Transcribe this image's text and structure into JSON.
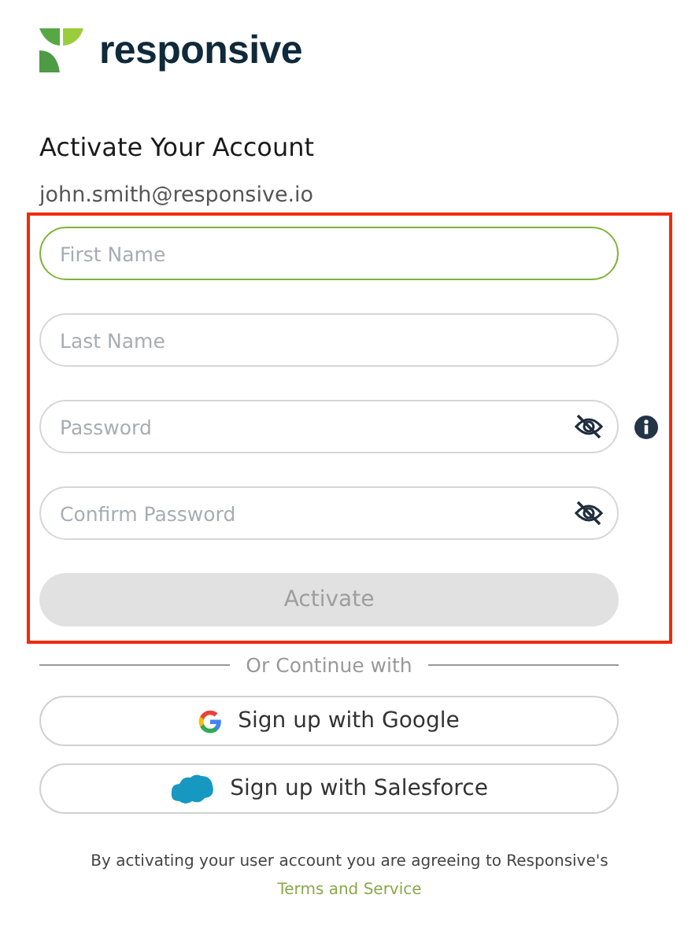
{
  "brand": {
    "name": "responsive"
  },
  "heading": "Activate Your Account",
  "email": "john.smith@responsive.io",
  "highlight": {
    "shown": true
  },
  "fields": [
    {
      "kind": "text",
      "placeholder": "First Name",
      "focused": true
    },
    {
      "kind": "text",
      "placeholder": "Last Name",
      "focused": false
    },
    {
      "kind": "password",
      "placeholder": "Password",
      "focused": false,
      "info": true
    },
    {
      "kind": "password",
      "placeholder": "Confirm Password",
      "focused": false,
      "info": false
    }
  ],
  "activate_button": {
    "label": "Activate",
    "disabled": true
  },
  "divider_text": "Or Continue with",
  "social_buttons": [
    {
      "kind": "google",
      "label": "Sign up with Google"
    },
    {
      "kind": "salesforce",
      "label": "Sign up with Salesforce"
    }
  ],
  "footer": {
    "text": "By activating your user account you are agreeing to Responsive's",
    "link": "Terms and Service"
  }
}
